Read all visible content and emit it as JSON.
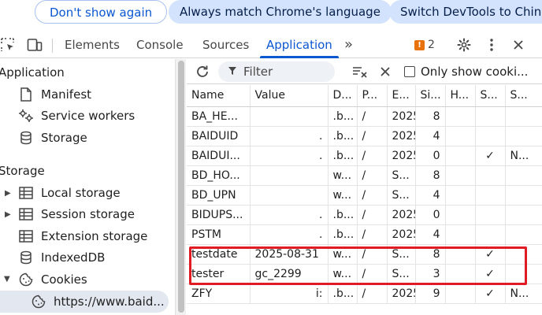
{
  "infobar": {
    "dont_show": "Don't show again",
    "always_match": "Always match Chrome's language",
    "switch_devtools": "Switch DevTools to Chin"
  },
  "toolbar": {
    "tabs": [
      "Elements",
      "Console",
      "Sources",
      "Application"
    ],
    "active_tab": "Application",
    "more": "»",
    "issues_count": "2"
  },
  "sidebar": {
    "application_heading": "Application",
    "application_items": [
      "Manifest",
      "Service workers",
      "Storage"
    ],
    "storage_heading": "Storage",
    "storage_items": [
      "Local storage",
      "Session storage",
      "Extension storage",
      "IndexedDB",
      "Cookies"
    ],
    "cookie_origin": "https://www.baid..."
  },
  "filterbar": {
    "filter_placeholder": "Filter",
    "only_show_label": "Only show cooki..."
  },
  "table": {
    "columns": [
      "Name",
      "Value",
      "D...",
      "P...",
      "E...",
      "Si...",
      "H...",
      "S...",
      "S..."
    ],
    "rows": [
      {
        "name": "BA_HE...",
        "value": "",
        "domain": ".b...",
        "path": "/",
        "expires": "2025...",
        "size": "8",
        "http": "",
        "secure": "",
        "samesite": ""
      },
      {
        "name": "BAIDUID",
        "value": ".",
        "domain": ".b...",
        "path": "/",
        "expires": "2025...",
        "size": "4",
        "http": "",
        "secure": "",
        "samesite": ""
      },
      {
        "name": "BAIDUI...",
        "value": ".",
        "domain": ".b...",
        "path": "/",
        "expires": "2025...",
        "size": "0",
        "http": "",
        "secure": "✓",
        "samesite": "N..."
      },
      {
        "name": "BD_HO...",
        "value": "",
        "domain": "w...",
        "path": "/",
        "expires": "S...",
        "size": "8",
        "http": "",
        "secure": "",
        "samesite": ""
      },
      {
        "name": "BD_UPN",
        "value": "",
        "domain": "w...",
        "path": "/",
        "expires": "S...",
        "size": "4",
        "http": "",
        "secure": "",
        "samesite": ""
      },
      {
        "name": "BIDUPS...",
        "value": ".",
        "domain": ".b...",
        "path": "/",
        "expires": "2025...",
        "size": "0",
        "http": "",
        "secure": "",
        "samesite": ""
      },
      {
        "name": "PSTM",
        "value": ".",
        "domain": ".b...",
        "path": "/",
        "expires": "2025...",
        "size": "4",
        "http": "",
        "secure": "",
        "samesite": ""
      },
      {
        "name": "testdate",
        "value": "2025-08-31",
        "domain": "w...",
        "path": "/",
        "expires": "S...",
        "size": "8",
        "http": "",
        "secure": "✓",
        "samesite": ""
      },
      {
        "name": "tester",
        "value": "gc_2299",
        "domain": "w...",
        "path": "/",
        "expires": "S...",
        "size": "3",
        "http": "",
        "secure": "✓",
        "samesite": ""
      },
      {
        "name": "ZFY",
        "value": "i:",
        "domain": ".b...",
        "path": "/",
        "expires": "2025...",
        "size": "9",
        "http": "",
        "secure": "✓",
        "samesite": "N..."
      }
    ]
  },
  "colors": {
    "accent": "#0b57d0",
    "highlight": "#e01b24",
    "issue_badge": "#e8710a"
  }
}
